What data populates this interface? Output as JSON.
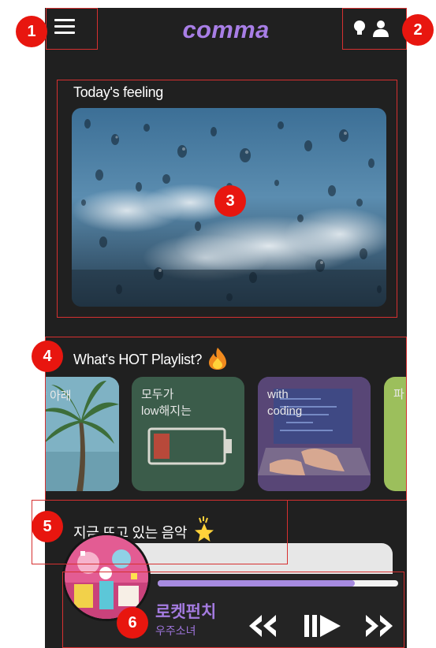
{
  "app": {
    "brand": "comma"
  },
  "sections": {
    "feeling_title": "Today's feeling",
    "hot_title": "What's HOT Playlist?",
    "now_playing_title": "지금 뜨고 있는 음악"
  },
  "playlists": [
    {
      "label": "양 아래",
      "color": "#6aa3b5"
    },
    {
      "label_line1": "모두가",
      "label_line2": "low해지는",
      "color": "#3a5a48"
    },
    {
      "label_line1": "with",
      "label_line2": "coding",
      "color": "#4a3a70"
    },
    {
      "label": "파",
      "color": "#9cbf5c"
    }
  ],
  "now_playing": {
    "title": "로켓펀치",
    "artist": "우주소녀",
    "progress": 0.82
  },
  "annotations": [
    "1",
    "2",
    "3",
    "4",
    "5",
    "6"
  ],
  "colors": {
    "accent": "#a87ee6",
    "marker": "#e8160f",
    "background": "#202020"
  },
  "icons": [
    "menu-icon",
    "lightbulb-icon",
    "user-icon",
    "fire-icon",
    "star-icon",
    "rewind-icon",
    "play-pause-icon",
    "fast-forward-icon"
  ]
}
